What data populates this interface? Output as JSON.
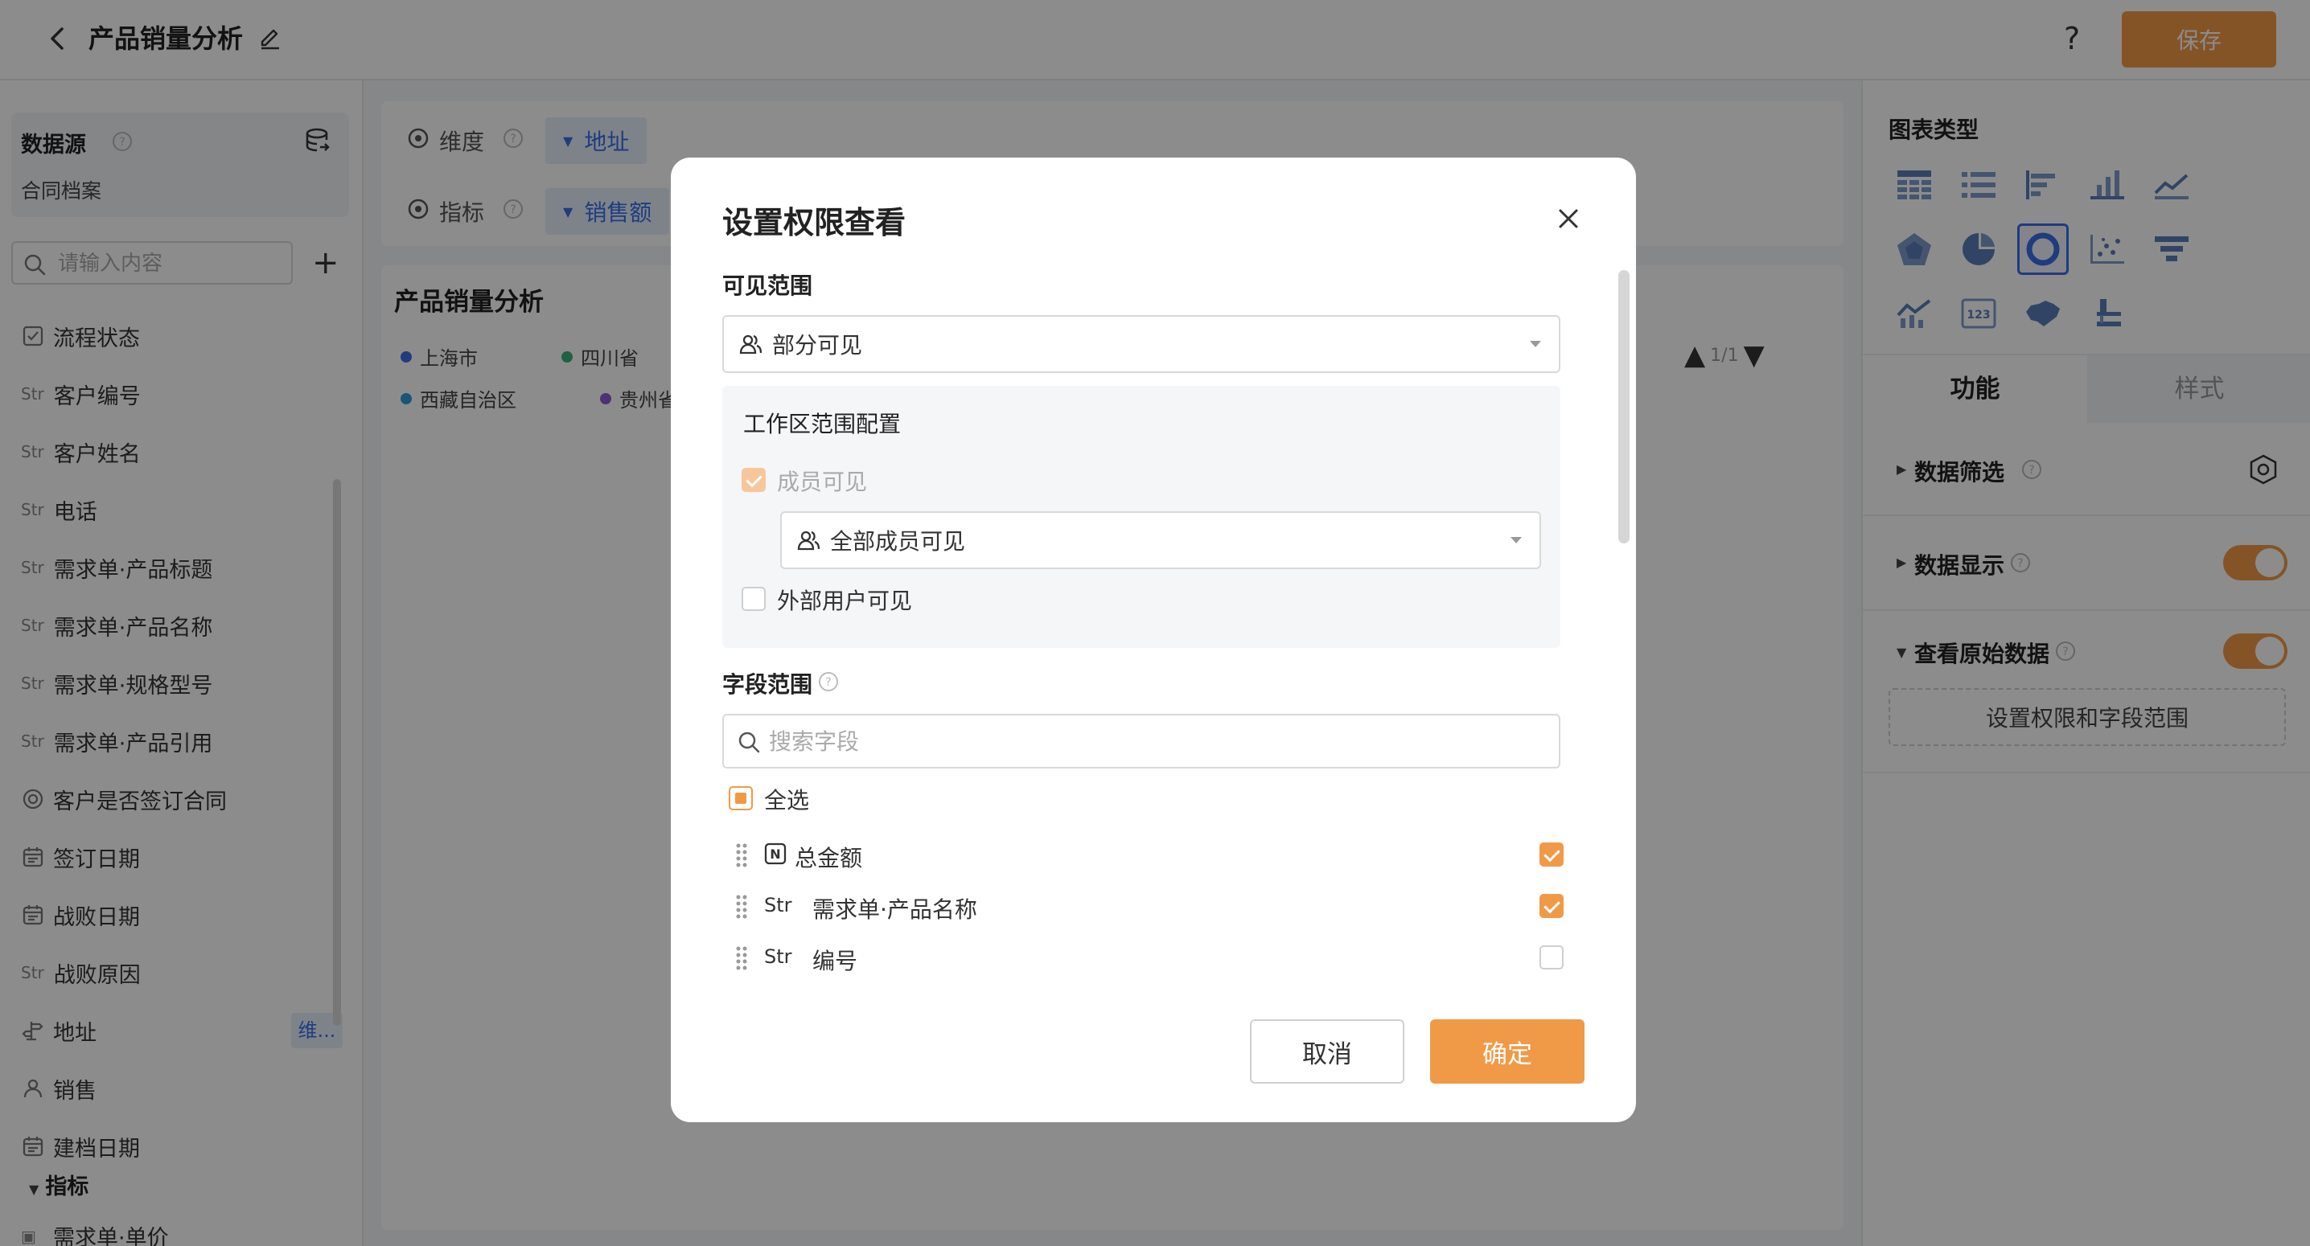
{
  "header": {
    "title": "产品销量分析",
    "help": "?",
    "save_label": "保存"
  },
  "datasource": {
    "label": "数据源",
    "name": "合同档案"
  },
  "left_search": {
    "placeholder": "请输入内容"
  },
  "fields": [
    {
      "type": "check",
      "label": "流程状态"
    },
    {
      "type": "str",
      "label": "客户编号"
    },
    {
      "type": "str",
      "label": "客户姓名"
    },
    {
      "type": "str",
      "label": "电话"
    },
    {
      "type": "str",
      "label": "需求单·产品标题"
    },
    {
      "type": "str",
      "label": "需求单·产品名称"
    },
    {
      "type": "str",
      "label": "需求单·规格型号"
    },
    {
      "type": "str",
      "label": "需求单·产品引用"
    },
    {
      "type": "radio",
      "label": "客户是否签订合同"
    },
    {
      "type": "date",
      "label": "签订日期"
    },
    {
      "type": "date",
      "label": "战败日期"
    },
    {
      "type": "str",
      "label": "战败原因"
    },
    {
      "type": "addr",
      "label": "地址",
      "tag": "维..."
    },
    {
      "type": "user",
      "label": "销售"
    },
    {
      "type": "date",
      "label": "建档日期"
    }
  ],
  "str_prefix": "Str",
  "metric_section": "指标",
  "metric_partial": "需求单·单价",
  "config": {
    "dimension_label": "维度",
    "dimension_pill": "地址",
    "metric_label": "指标",
    "metric_pill": "销售额"
  },
  "chart": {
    "title": "产品销量分析",
    "legend": [
      {
        "name": "上海市",
        "color": "#3a6ee8"
      },
      {
        "name": "四川省",
        "color": "#36b37e"
      },
      {
        "name": "西藏自治区",
        "color": "#2f9bd6"
      },
      {
        "name": "贵州省",
        "color": "#8e5ad6"
      }
    ],
    "pager": "1/1"
  },
  "right": {
    "chart_types_title": "图表类型",
    "tabs": [
      "功能",
      "样式"
    ],
    "sections": [
      {
        "name": "数据筛选",
        "has_toggle": false
      },
      {
        "name": "数据显示",
        "has_toggle": true
      },
      {
        "name": "查看原始数据",
        "has_toggle": true
      }
    ],
    "perm_button": "设置权限和字段范围"
  },
  "modal": {
    "title": "设置权限查看",
    "visible_scope_label": "可见范围",
    "visible_scope_value": "部分可见",
    "workspace_title": "工作区范围配置",
    "member_visible_label": "成员可见",
    "member_select_value": "全部成员可见",
    "external_label": "外部用户可见",
    "field_scope_label": "字段范围",
    "field_search_placeholder": "搜索字段",
    "select_all_label": "全选",
    "field_rows": [
      {
        "icon": "N",
        "name": "总金额",
        "checked": true
      },
      {
        "icon": "Str",
        "name": "需求单·产品名称",
        "checked": true
      },
      {
        "icon": "Str",
        "name": "编号",
        "checked": false
      }
    ],
    "cancel_label": "取消",
    "ok_label": "确定"
  },
  "colors": {
    "accent": "#f09a48",
    "primary_blue": "#3a6ee8"
  }
}
